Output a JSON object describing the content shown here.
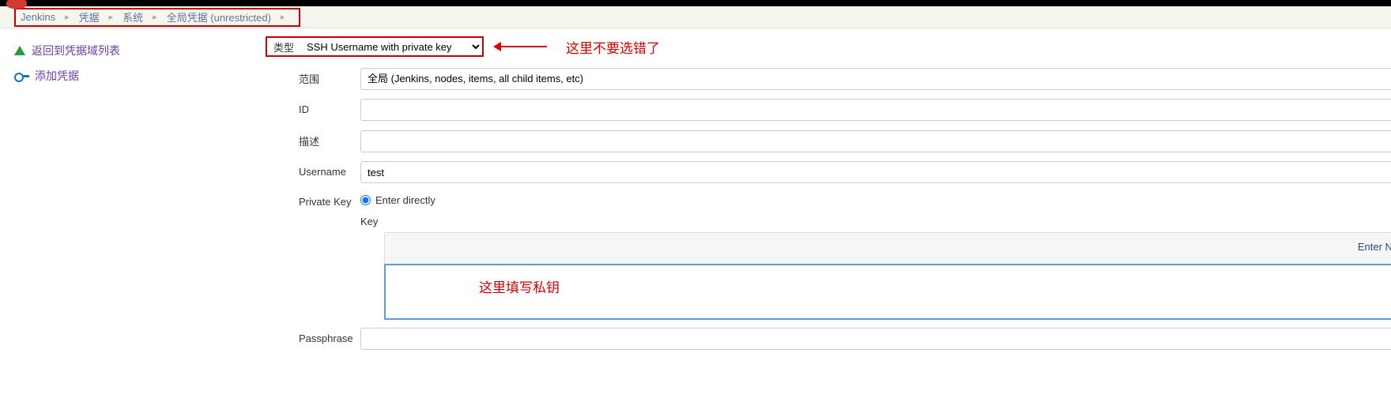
{
  "breadcrumb": {
    "items": [
      "Jenkins",
      "凭据",
      "系统",
      "全局凭据 (unrestricted)"
    ]
  },
  "sidepanel": {
    "back_link": "返回到凭据域列表",
    "add_link": "添加凭据"
  },
  "form": {
    "type_label": "类型",
    "type_value": "SSH Username with private key",
    "scope_label": "范围",
    "scope_value": "全局 (Jenkins, nodes, items, all child items, etc)",
    "id_label": "ID",
    "id_value": "",
    "description_label": "描述",
    "description_value": "",
    "username_label": "Username",
    "username_value": "test",
    "privatekey_label": "Private Key",
    "enter_directly_label": "Enter directly",
    "key_label": "Key",
    "enter_new_label": "Enter New",
    "key_value": "",
    "passphrase_label": "Passphrase",
    "passphrase_value": ""
  },
  "annotations": {
    "type_note": "这里不要选错了",
    "key_note": "这里填写私钥"
  }
}
